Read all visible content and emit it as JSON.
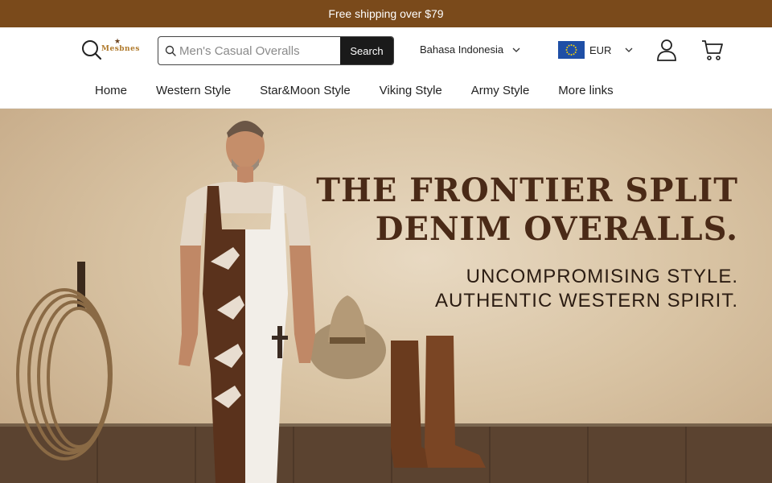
{
  "announcement": {
    "text": "Free shipping over $79"
  },
  "header": {
    "logo_text": "Mesbnes",
    "search": {
      "placeholder": "Men's Casual Overalls",
      "button_label": "Search"
    },
    "language": {
      "label": "Bahasa Indonesia"
    },
    "currency": {
      "label": "EUR"
    }
  },
  "nav": {
    "items": [
      {
        "label": "Home"
      },
      {
        "label": "Western Style"
      },
      {
        "label": "Star&Moon Style"
      },
      {
        "label": "Viking Style"
      },
      {
        "label": "Army Style"
      },
      {
        "label": "More links"
      }
    ]
  },
  "hero": {
    "headline_line1": "THE FRONTIER SPLIT",
    "headline_line2": "DENIM OVERALLS.",
    "sub_line1": "UNCOMPROMISING STYLE.",
    "sub_line2": "AUTHENTIC WESTERN SPIRIT."
  },
  "colors": {
    "announcement_bg": "#7a4a1b",
    "headline": "#4a2a17",
    "search_button": "#1a1a1a"
  },
  "icons": [
    "search-icon",
    "logo",
    "chevron-down-icon",
    "eu-flag-icon",
    "account-icon",
    "cart-icon"
  ]
}
